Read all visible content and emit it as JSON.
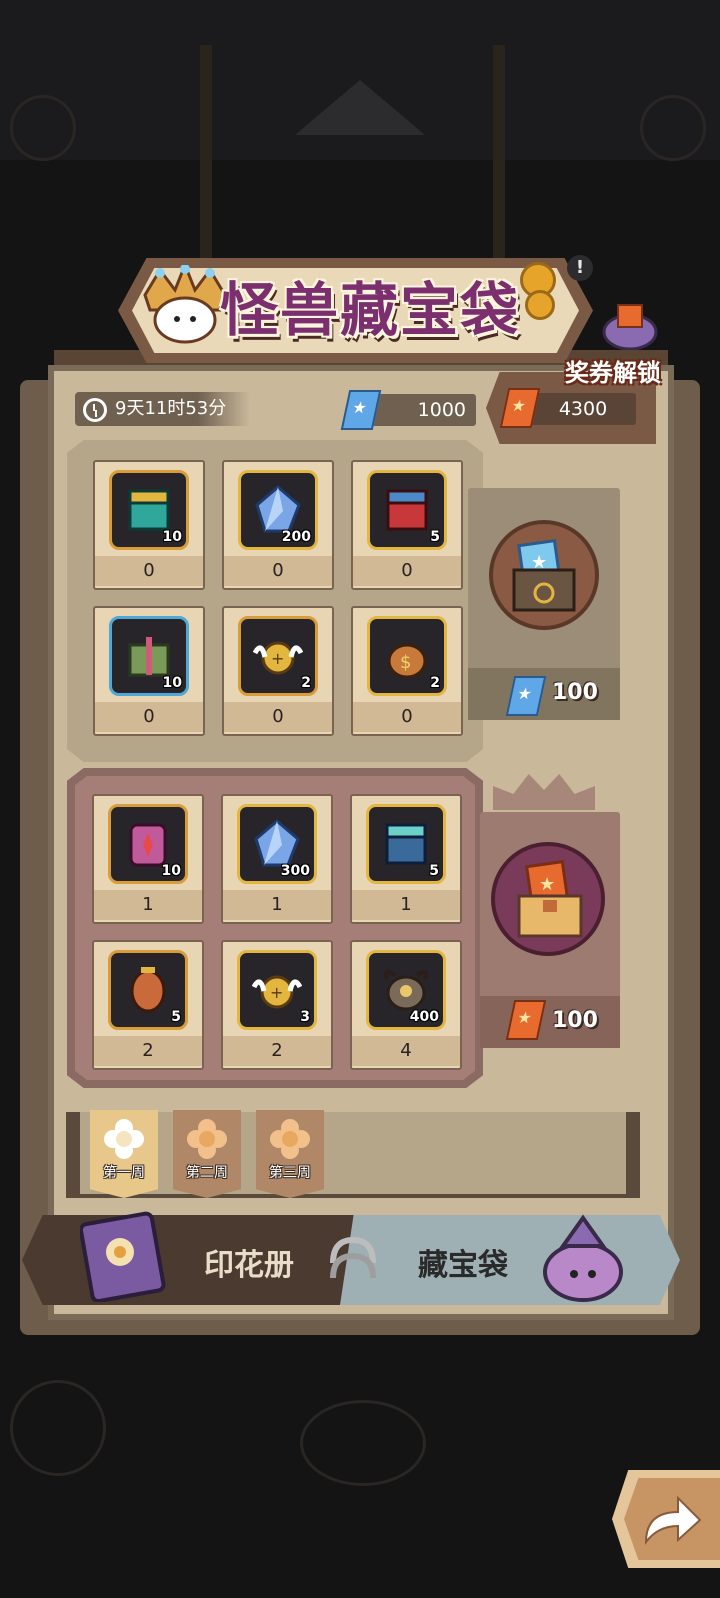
{
  "title": "怪兽藏宝袋",
  "timer": "9天11时53分",
  "currency_blue": "1000",
  "currency_orange": "4300",
  "unlock_label": "奖券解锁",
  "normal_pool": {
    "items": [
      {
        "name": "chest-teal-icon",
        "qty": "10",
        "count": "0",
        "frame": "orange"
      },
      {
        "name": "crystal-icon",
        "qty": "200",
        "count": "0",
        "frame": "gold"
      },
      {
        "name": "chest-red-icon",
        "qty": "5",
        "count": "0",
        "frame": "gold"
      },
      {
        "name": "gift-box-icon",
        "qty": "10",
        "count": "0",
        "frame": "blue"
      },
      {
        "name": "angel-coin-icon",
        "qty": "2",
        "count": "0",
        "frame": "orange"
      },
      {
        "name": "money-bag-icon",
        "qty": "2",
        "count": "0",
        "frame": "gold"
      }
    ],
    "price": "100"
  },
  "premium_pool": {
    "items": [
      {
        "name": "armor-pink-icon",
        "qty": "10",
        "count": "1",
        "frame": "orange"
      },
      {
        "name": "crystal-icon",
        "qty": "300",
        "count": "1",
        "frame": "gold"
      },
      {
        "name": "chest-blue-icon",
        "qty": "5",
        "count": "1",
        "frame": "gold"
      },
      {
        "name": "lantern-icon",
        "qty": "5",
        "count": "2",
        "frame": "orange"
      },
      {
        "name": "angel-coin-icon",
        "qty": "3",
        "count": "2",
        "frame": "gold"
      },
      {
        "name": "monster-head-icon",
        "qty": "400",
        "count": "4",
        "frame": "gold"
      }
    ],
    "price": "100"
  },
  "weeks": [
    "第一周",
    "第二周",
    "第三周"
  ],
  "nav": {
    "stamp_book": "印花册",
    "treasure_bag": "藏宝袋"
  },
  "colors": {
    "title": "#7b2f6e",
    "board": "#c9b89a",
    "premium": "#a57e78"
  }
}
